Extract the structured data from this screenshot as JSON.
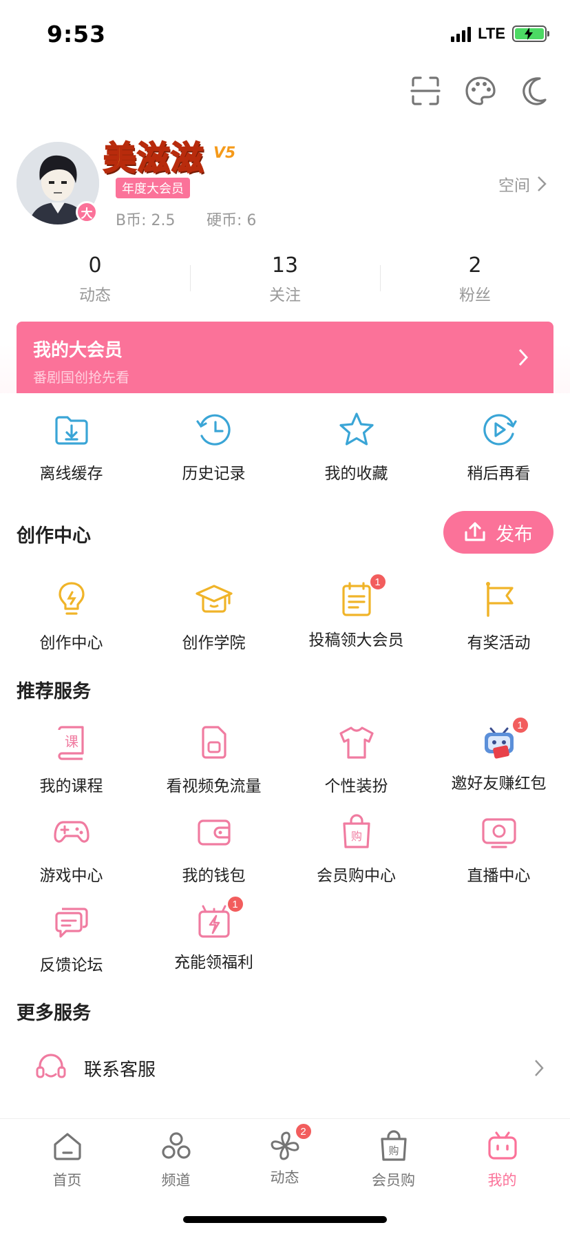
{
  "status_bar": {
    "time": "9:53",
    "network": "LTE"
  },
  "top_icons": [
    "scan-icon",
    "palette-icon",
    "moon-icon"
  ],
  "profile": {
    "username": "美滋滋",
    "level": "V5",
    "vip_tag": "年度大会员",
    "avatar_badge": "大",
    "b_coin": "B币: 2.5",
    "coin": "硬币: 6",
    "space_link": "空间"
  },
  "stats": [
    {
      "value": "0",
      "label": "动态"
    },
    {
      "value": "13",
      "label": "关注"
    },
    {
      "value": "2",
      "label": "粉丝"
    }
  ],
  "vip_banner": {
    "title": "我的大会员",
    "subtitle": "番剧国创抢先看"
  },
  "quick_actions": [
    {
      "label": "离线缓存",
      "icon": "download-folder-icon"
    },
    {
      "label": "历史记录",
      "icon": "history-clock-icon"
    },
    {
      "label": "我的收藏",
      "icon": "star-icon"
    },
    {
      "label": "稍后再看",
      "icon": "watch-later-icon"
    }
  ],
  "creation": {
    "title": "创作中心",
    "publish_label": "发布",
    "items": [
      {
        "label": "创作中心",
        "icon": "lightbulb-icon"
      },
      {
        "label": "创作学院",
        "icon": "graduation-cap-icon"
      },
      {
        "label": "投稿领大会员",
        "icon": "document-icon",
        "badge": "1"
      },
      {
        "label": "有奖活动",
        "icon": "flag-icon"
      }
    ]
  },
  "recommended": {
    "title": "推荐服务",
    "items": [
      {
        "label": "我的课程",
        "icon": "course-book-icon"
      },
      {
        "label": "看视频免流量",
        "icon": "sim-card-icon"
      },
      {
        "label": "个性装扮",
        "icon": "tshirt-icon"
      },
      {
        "label": "邀好友赚红包",
        "icon": "tv-mascot-icon",
        "badge": "1"
      },
      {
        "label": "游戏中心",
        "icon": "gamepad-icon"
      },
      {
        "label": "我的钱包",
        "icon": "wallet-icon"
      },
      {
        "label": "会员购中心",
        "icon": "shopping-bag-icon"
      },
      {
        "label": "直播中心",
        "icon": "live-tv-icon"
      },
      {
        "label": "反馈论坛",
        "icon": "chat-bubbles-icon"
      },
      {
        "label": "充能领福利",
        "icon": "gift-charge-icon",
        "badge": "1"
      }
    ]
  },
  "more_services": {
    "title": "更多服务",
    "contact_label": "联系客服"
  },
  "tabbar": [
    {
      "label": "首页",
      "icon": "home-icon"
    },
    {
      "label": "频道",
      "icon": "channel-icon"
    },
    {
      "label": "动态",
      "icon": "pinwheel-icon",
      "badge": "2"
    },
    {
      "label": "会员购",
      "icon": "shopping-bag-icon"
    },
    {
      "label": "我的",
      "icon": "tv-icon",
      "active": true
    }
  ],
  "colors": {
    "accent": "#fb7299",
    "blue_icon": "#3aa5d6",
    "yellow_icon": "#f0b429",
    "pink_icon": "#f07ba0"
  }
}
